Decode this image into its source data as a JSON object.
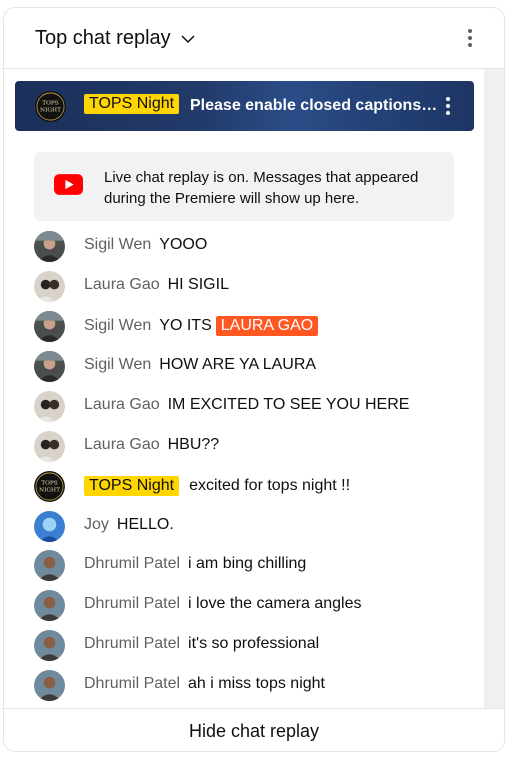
{
  "header": {
    "title": "Top chat replay",
    "chevron_icon": "chevron-down-icon",
    "menu_icon": "kebab-menu-icon"
  },
  "pinned": {
    "badge": "TOPS Night",
    "message": "Please enable closed captions…",
    "menu_icon": "kebab-menu-icon",
    "avatar_text_1": "TOPS",
    "avatar_text_2": "NIGHT"
  },
  "notice": {
    "icon": "youtube-icon",
    "text": "Live chat replay is on. Messages that appeared during the Premiere will show up here."
  },
  "messages": [
    {
      "author": "Sigil Wen",
      "text": "YOOO"
    },
    {
      "author": "Laura Gao",
      "text": "HI SIGIL"
    },
    {
      "author": "Sigil Wen",
      "text": "YO ITS",
      "mention": "LAURA GAO"
    },
    {
      "author": "Sigil Wen",
      "text": "HOW ARE YA LAURA"
    },
    {
      "author": "Laura Gao",
      "text": "IM EXCITED TO SEE YOU HERE"
    },
    {
      "author": "Laura Gao",
      "text": "HBU??"
    },
    {
      "author": "TOPS Night",
      "text": "excited for tops night !!"
    },
    {
      "author": "Joy",
      "text": "HELLO."
    },
    {
      "author": "Dhrumil Patel",
      "text": "i am bing chilling"
    },
    {
      "author": "Dhrumil Patel",
      "text": "i love the camera angles"
    },
    {
      "author": "Dhrumil Patel",
      "text": "it's so professional"
    },
    {
      "author": "Dhrumil Patel",
      "text": "ah i miss tops night"
    }
  ],
  "footer": {
    "button": "Hide chat replay"
  },
  "colors": {
    "owner_badge": "#ffd600",
    "mention": "#ff5722",
    "banner": "#1e3564",
    "author": "#606060"
  }
}
